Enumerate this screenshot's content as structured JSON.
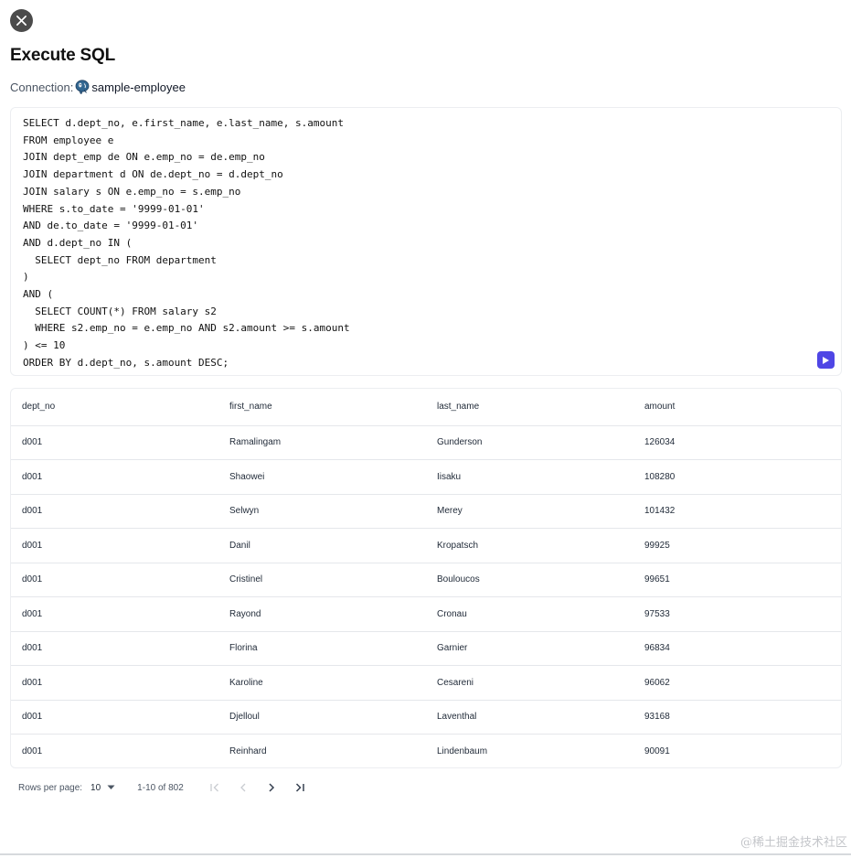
{
  "dialog": {
    "title": "Execute SQL",
    "connection_label": "Connection:",
    "connection_name": "sample-employee"
  },
  "editor": {
    "sql": "SELECT d.dept_no, e.first_name, e.last_name, s.amount\nFROM employee e\nJOIN dept_emp de ON e.emp_no = de.emp_no\nJOIN department d ON de.dept_no = d.dept_no\nJOIN salary s ON e.emp_no = s.emp_no\nWHERE s.to_date = '9999-01-01'\nAND de.to_date = '9999-01-01'\nAND d.dept_no IN (\n  SELECT dept_no FROM department\n)\nAND (\n  SELECT COUNT(*) FROM salary s2\n  WHERE s2.emp_no = e.emp_no AND s2.amount >= s.amount\n) <= 10\nORDER BY d.dept_no, s.amount DESC;"
  },
  "table": {
    "columns": [
      "dept_no",
      "first_name",
      "last_name",
      "amount"
    ],
    "rows": [
      [
        "d001",
        "Ramalingam",
        "Gunderson",
        "126034"
      ],
      [
        "d001",
        "Shaowei",
        "Iisaku",
        "108280"
      ],
      [
        "d001",
        "Selwyn",
        "Merey",
        "101432"
      ],
      [
        "d001",
        "Danil",
        "Kropatsch",
        "99925"
      ],
      [
        "d001",
        "Cristinel",
        "Bouloucos",
        "99651"
      ],
      [
        "d001",
        "Rayond",
        "Cronau",
        "97533"
      ],
      [
        "d001",
        "Florina",
        "Garnier",
        "96834"
      ],
      [
        "d001",
        "Karoline",
        "Cesareni",
        "96062"
      ],
      [
        "d001",
        "Djelloul",
        "Laventhal",
        "93168"
      ],
      [
        "d001",
        "Reinhard",
        "Lindenbaum",
        "90091"
      ]
    ]
  },
  "pagination": {
    "rows_per_page_label": "Rows per page:",
    "rows_per_page_value": "10",
    "range_text": "1-10 of 802"
  },
  "watermark": "@稀土掘金技术社区",
  "icons": {
    "close": "close-icon",
    "database": "postgresql-elephant-icon",
    "run": "play-icon",
    "first": "first-page-icon",
    "prev": "chevron-left-icon",
    "next": "chevron-right-icon",
    "last": "last-page-icon"
  },
  "colors": {
    "accent": "#4f46e5",
    "close_bg": "#4b4b4b",
    "disabled": "#c9ccd1"
  }
}
